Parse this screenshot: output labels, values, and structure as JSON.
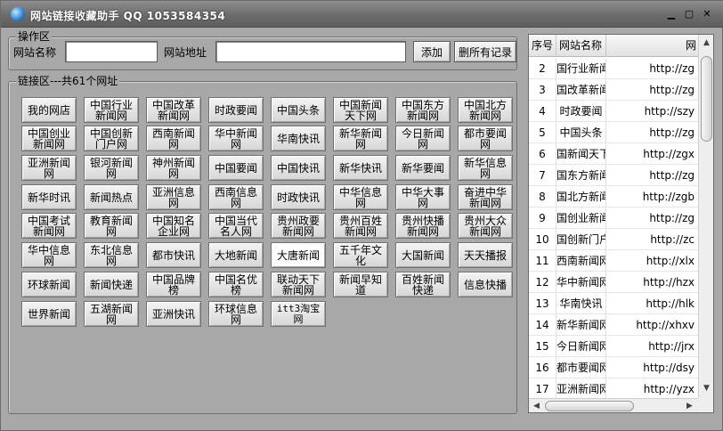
{
  "window": {
    "title": "网站链接收藏助手 QQ 1053584354",
    "min_glyph": "▁",
    "max_glyph": "▢",
    "close_glyph": "✕"
  },
  "ops": {
    "legend": "操作区",
    "name_label": "网站名称",
    "name_value": "",
    "url_label": "网站地址",
    "url_value": "",
    "add_button": "添加",
    "delete_all_button": "删所有记录"
  },
  "links": {
    "legend": "链接区---共61个网址",
    "sites": [
      "我的网店",
      "中国行业新闻网",
      "中国改革新闻网",
      "时政要闻",
      "中国头条",
      "中国新闻天下网",
      "中国东方新闻网",
      "中国北方新闻网",
      "中国创业新闻网",
      "中国创新门户网",
      "西南新闻网",
      "华中新闻网",
      "华南快讯",
      "新华新闻网",
      "今日新闻网",
      "都市要闻网",
      "亚洲新闻网",
      "银河新闻网",
      "神州新闻网",
      "中国要闻",
      "中国快讯",
      "新华快讯",
      "新华要闻",
      "新华信息网",
      "新华时讯",
      "新闻热点",
      "亚洲信息网",
      "西南信息网",
      "时政快讯",
      "中华信息网",
      "中华大事网",
      "奋进中华新闻网",
      "中国考试新闻网",
      "教育新闻网",
      "中国知名企业网",
      "中国当代名人网",
      "贵州政要新闻网",
      "贵州百姓新闻网",
      "贵州快播新闻网",
      "贵州大众新闻网",
      "华中信息网",
      "东北信息网",
      "都市快讯",
      "大地新闻",
      "大唐新闻",
      "五千年文化",
      "大国新闻",
      "天天播报",
      "环球新闻",
      "新闻快递",
      "中国品牌榜",
      "中国名优榜",
      "联动天下新闻网",
      "新闻早知道",
      "百姓新闻快递",
      "信息快播",
      "世界新闻",
      "五湖新闻网",
      "亚洲快讯",
      "环球信息网",
      "itt3淘宝网"
    ]
  },
  "table": {
    "headers": [
      "序号",
      "网站名称",
      "网"
    ],
    "rows": [
      {
        "no": "2",
        "name": "国行业新闻",
        "url": "http://zg"
      },
      {
        "no": "3",
        "name": "国改革新闻",
        "url": "http://zg"
      },
      {
        "no": "4",
        "name": "时政要闻",
        "url": "http://szy"
      },
      {
        "no": "5",
        "name": "中国头条",
        "url": "http://zg"
      },
      {
        "no": "6",
        "name": "国新闻天下",
        "url": "http://zgx"
      },
      {
        "no": "7",
        "name": "国东方新闻",
        "url": "http://zg"
      },
      {
        "no": "8",
        "name": "国北方新闻",
        "url": "http://zgb"
      },
      {
        "no": "9",
        "name": "国创业新闻",
        "url": "http://zg"
      },
      {
        "no": "10",
        "name": "国创新门户",
        "url": "http://zc"
      },
      {
        "no": "11",
        "name": "西南新闻网",
        "url": "http://xlx"
      },
      {
        "no": "12",
        "name": "华中新闻网",
        "url": "http://hzx"
      },
      {
        "no": "13",
        "name": "华南快讯",
        "url": "http://hlk"
      },
      {
        "no": "14",
        "name": "新华新闻网",
        "url": "http://xhxv"
      },
      {
        "no": "15",
        "name": "今日新闻网",
        "url": "http://jrx"
      },
      {
        "no": "16",
        "name": "都市要闻网",
        "url": "http://dsy"
      },
      {
        "no": "17",
        "name": "亚洲新闻网",
        "url": "http://yzx"
      }
    ]
  },
  "colors": {
    "background": "#a8a8a8",
    "titlebar": "#6c6c6c",
    "button_face": "#e4e4e4"
  }
}
